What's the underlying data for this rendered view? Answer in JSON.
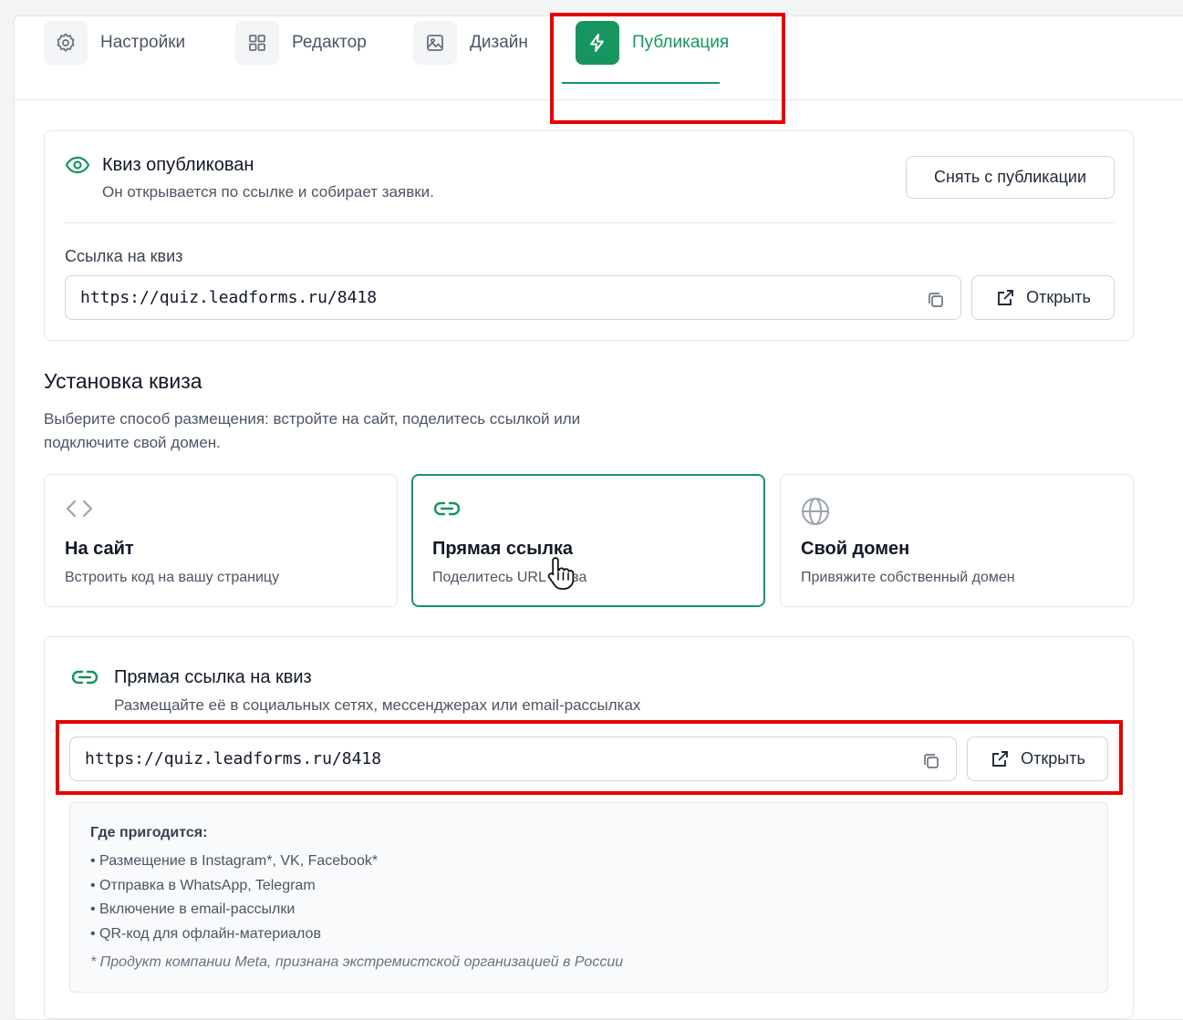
{
  "tabs": [
    {
      "label": "Настройки",
      "icon": "gear-icon"
    },
    {
      "label": "Редактор",
      "icon": "grid-icon"
    },
    {
      "label": "Дизайн",
      "icon": "image-icon"
    },
    {
      "label": "Публикация",
      "icon": "lightning-icon",
      "active": true
    }
  ],
  "status": {
    "title": "Квиз опубликован",
    "subtitle": "Он открывается по ссылке и собирает заявки.",
    "unpublish_label": "Снять с публикации",
    "link_label": "Ссылка на квиз",
    "url": "https://quiz.leadforms.ru/8418",
    "open_label": "Открыть"
  },
  "install": {
    "title": "Установка квиза",
    "desc_line1": "Выберите способ размещения: встройте на сайт, поделитесь ссылкой или",
    "desc_line2": "подключите свой домен.",
    "options": [
      {
        "title": "На сайт",
        "subtitle": "Встроить код на вашу страницу",
        "icon": "code-icon"
      },
      {
        "title": "Прямая ссылка",
        "subtitle": "Поделитесь URL квиза",
        "icon": "link-icon",
        "selected": true
      },
      {
        "title": "Свой домен",
        "subtitle": "Привяжите собственный домен",
        "icon": "globe-icon"
      }
    ]
  },
  "direct": {
    "title": "Прямая ссылка на квиз",
    "subtitle": "Размещайте её в социальных сетях, мессенджерах или email-рассылках",
    "url": "https://quiz.leadforms.ru/8418",
    "open_label": "Открыть",
    "info_title": "Где пригодится:",
    "items": [
      "• Размещение в Instagram*, VK, Facebook*",
      "• Отправка в WhatsApp, Telegram",
      "• Включение в email-рассылки",
      "• QR-код для офлайн-материалов"
    ],
    "note": "* Продукт компании Meta, признана экстремистской организацией в России"
  },
  "colors": {
    "accent": "#16955e",
    "highlight": "#e60000"
  }
}
